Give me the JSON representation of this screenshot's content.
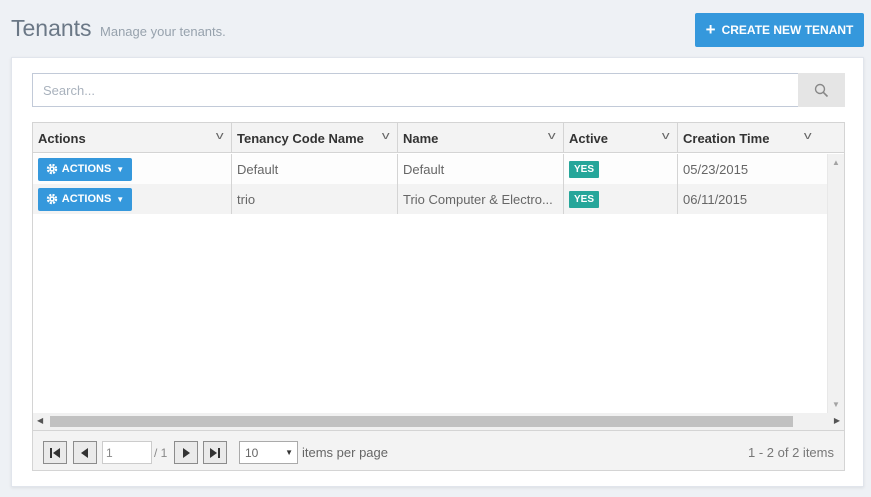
{
  "header": {
    "title": "Tenants",
    "subtitle": "Manage your tenants.",
    "create_button_label": "CREATE NEW TENANT"
  },
  "search": {
    "placeholder": "Search...",
    "value": ""
  },
  "grid": {
    "columns": [
      "Actions",
      "Tenancy Code Name",
      "Name",
      "Active",
      "Creation Time"
    ],
    "rows": [
      {
        "actions_label": "ACTIONS",
        "code": "Default",
        "name": "Default",
        "active": "YES",
        "creation_time": "05/23/2015"
      },
      {
        "actions_label": "ACTIONS",
        "code": "trio",
        "name": "Trio Computer & Electro...",
        "active": "YES",
        "creation_time": "06/11/2015"
      }
    ]
  },
  "pager": {
    "current_page": "1",
    "total_pages": "/ 1",
    "page_size": "10",
    "page_size_label": "items per page",
    "items_info": "1 - 2 of 2 items"
  },
  "colors": {
    "primary": "#3598dc",
    "active_badge": "#26a69a",
    "background": "#eef1f5"
  },
  "icons": {
    "create": "plus-icon",
    "search": "search-icon",
    "actions": "gear-icon",
    "sort": "chevron-down-icon"
  }
}
